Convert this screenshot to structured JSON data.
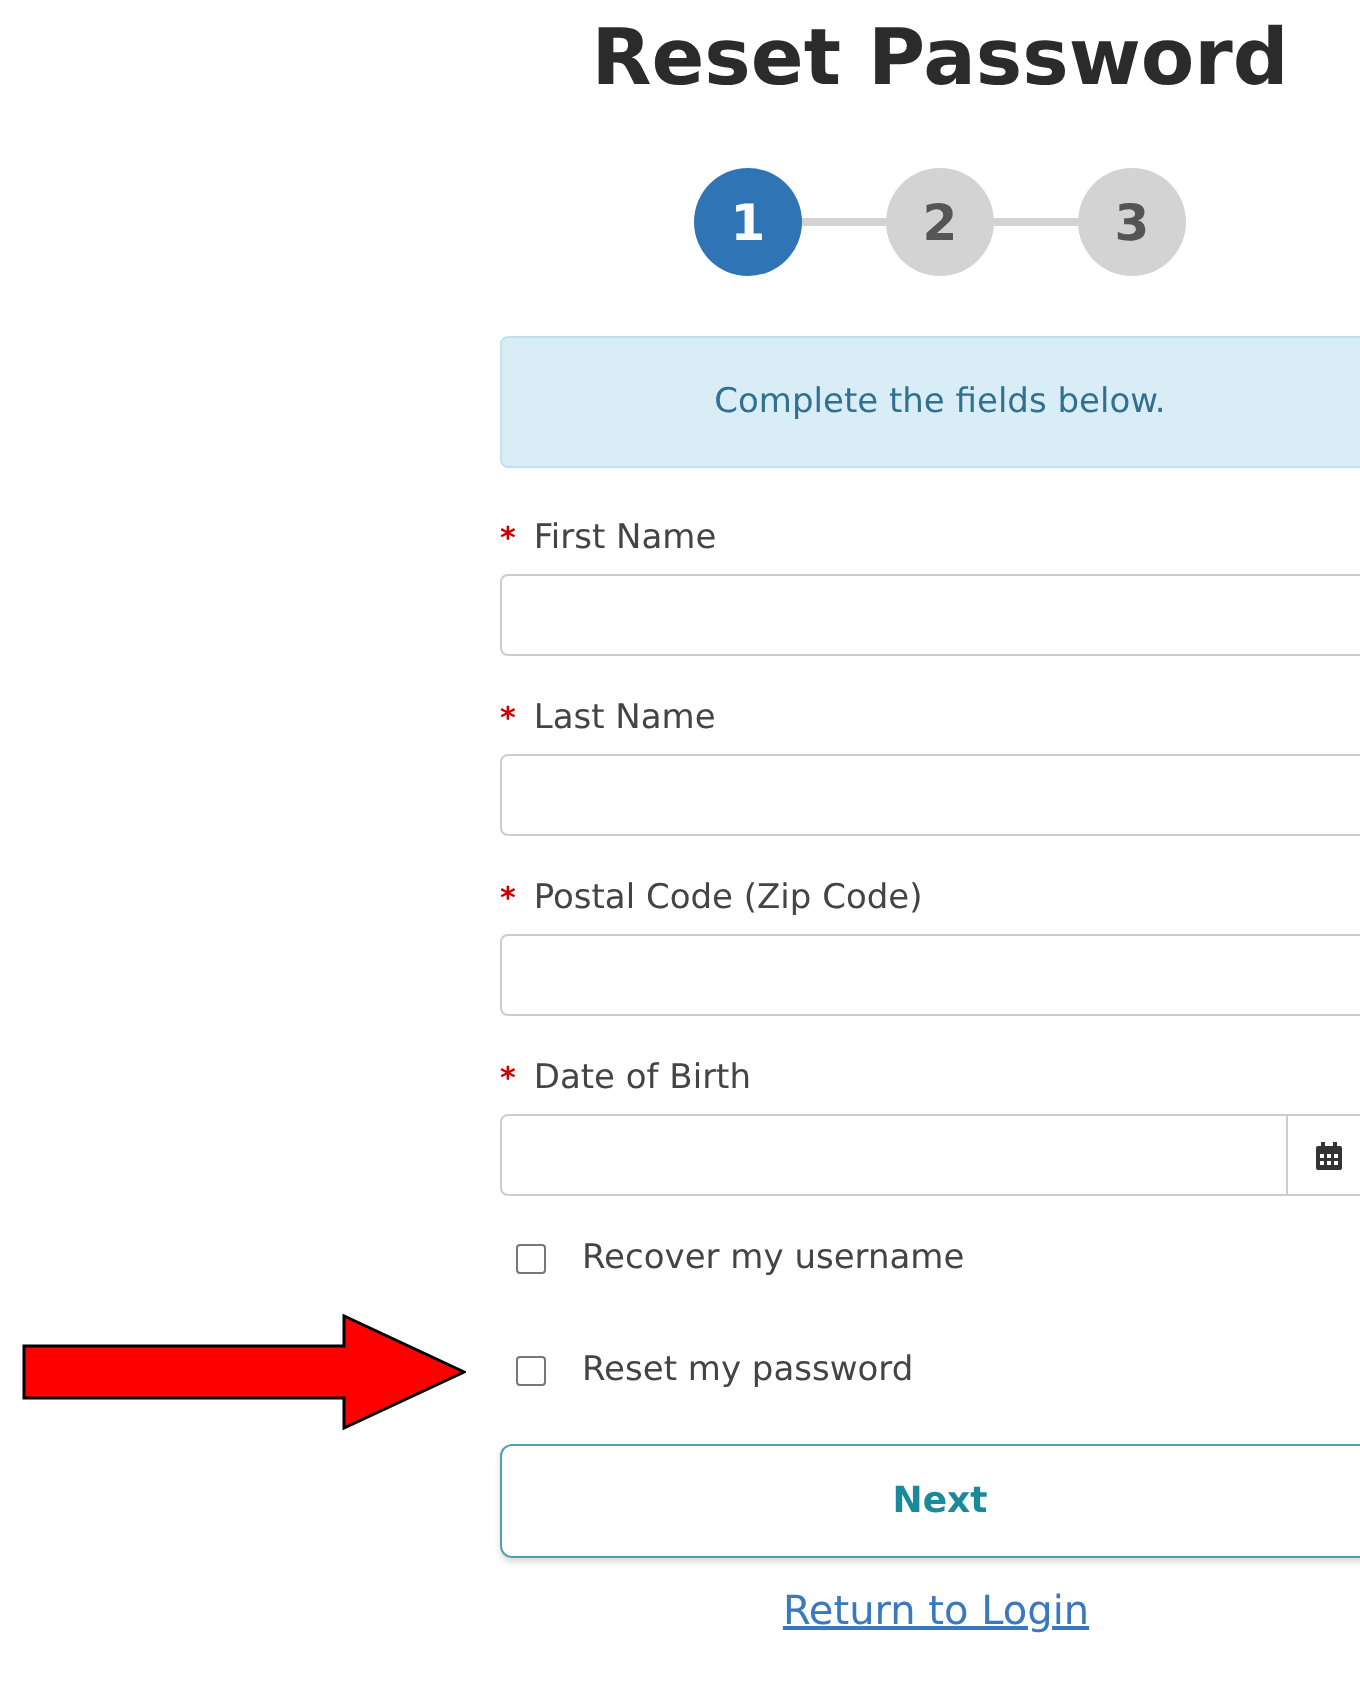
{
  "title": "Reset Password",
  "steps": [
    {
      "label": "1",
      "selected": true
    },
    {
      "label": "2",
      "selected": false
    },
    {
      "label": "3",
      "selected": false
    }
  ],
  "notice": "Complete the fields below.",
  "fields": [
    {
      "kind": "text",
      "label": "First Name",
      "required_mark": "*"
    },
    {
      "kind": "text",
      "label": "Last Name",
      "required_mark": "*"
    },
    {
      "kind": "text",
      "label": "Postal Code (Zip Code)",
      "required_mark": "*"
    },
    {
      "kind": "date",
      "label": "Date of Birth",
      "required_mark": "*"
    }
  ],
  "options": [
    {
      "label": "Recover my username",
      "checked": false
    },
    {
      "label": "Reset my password",
      "checked": false
    }
  ],
  "next_button": "Next",
  "return_link": "Return to Login"
}
